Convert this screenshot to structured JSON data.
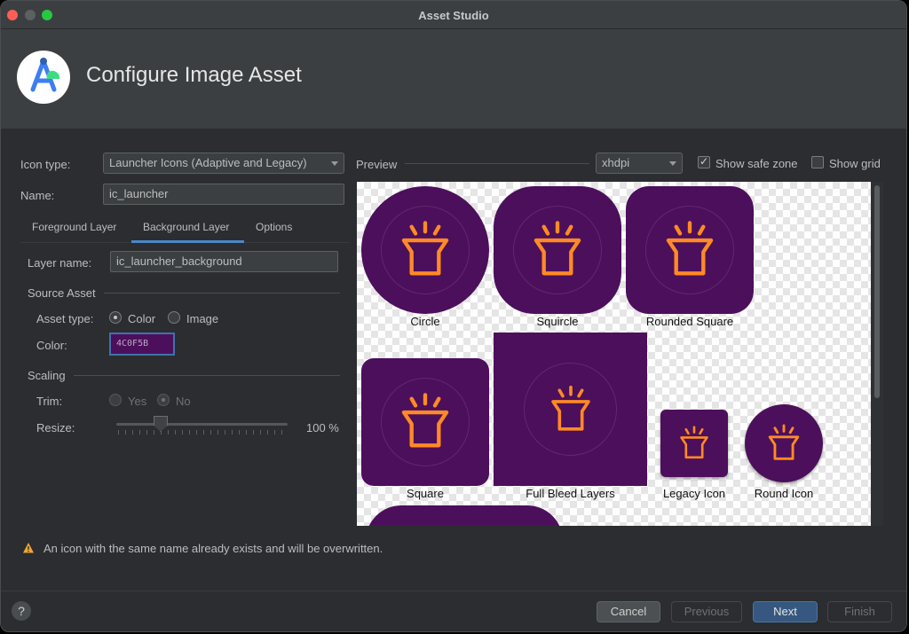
{
  "window": {
    "title": "Asset Studio"
  },
  "header": {
    "title": "Configure Image Asset"
  },
  "form": {
    "icon_type_label": "Icon type:",
    "icon_type_value": "Launcher Icons (Adaptive and Legacy)",
    "name_label": "Name:",
    "name_value": "ic_launcher"
  },
  "tabs": [
    {
      "label": "Foreground Layer"
    },
    {
      "label": "Background Layer"
    },
    {
      "label": "Options"
    }
  ],
  "layer": {
    "layer_name_label": "Layer name:",
    "layer_name_value": "ic_launcher_background",
    "source_asset_title": "Source Asset",
    "asset_type_label": "Asset type:",
    "asset_type_options": [
      "Color",
      "Image"
    ],
    "color_label": "Color:",
    "color_value": "4C0F5B",
    "scaling_title": "Scaling",
    "trim_label": "Trim:",
    "trim_options": [
      "Yes",
      "No"
    ],
    "resize_label": "Resize:",
    "resize_value": "100 %"
  },
  "preview": {
    "title": "Preview",
    "density": "xhdpi",
    "show_safe_zone_label": "Show safe zone",
    "show_safe_zone": true,
    "show_grid_label": "Show grid",
    "show_grid": false,
    "icons": [
      "Circle",
      "Squircle",
      "Rounded Square",
      "Square",
      "Full Bleed Layers",
      "Legacy Icon",
      "Round Icon"
    ]
  },
  "warning": {
    "text": "An icon with the same name already exists and will be overwritten."
  },
  "buttons": {
    "help": "?",
    "cancel": "Cancel",
    "previous": "Previous",
    "next": "Next",
    "finish": "Finish"
  },
  "colors": {
    "icon_background": "#4c0f5b",
    "icon_foreground": "#ff8a25",
    "accent": "#4a88c7"
  }
}
